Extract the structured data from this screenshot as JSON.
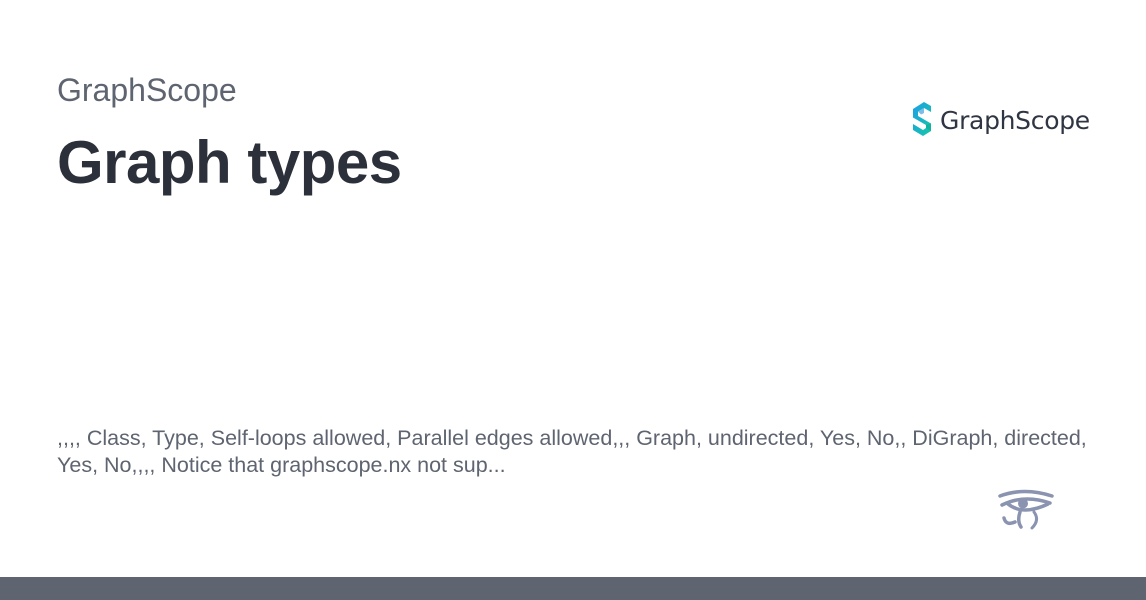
{
  "header": {
    "site_name": "GraphScope",
    "title": "Graph types"
  },
  "logo": {
    "text": "GraphScope",
    "icon": "graphscope-logo-icon",
    "colors": [
      "#1e9fe8",
      "#15c7a5"
    ]
  },
  "description": {
    "text": ",,,, Class, Type, Self-loops allowed, Parallel edges allowed,,, Graph, undirected, Yes, No,, DiGraph, directed, Yes, No,,,, Notice that graphscope.nx not sup..."
  },
  "footer": {
    "icon": "eye-of-horus-icon",
    "bar_color": "#5e6470"
  }
}
